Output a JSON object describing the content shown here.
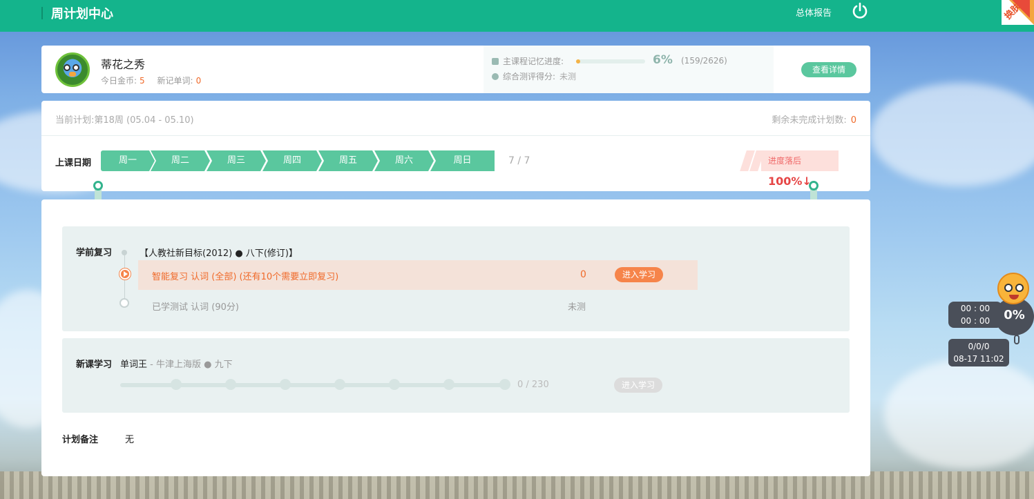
{
  "header": {
    "title": "周计划中心",
    "report_link": "总体报告",
    "skin_label": "换肤"
  },
  "profile": {
    "name": "蒂花之秀",
    "coins_label": "今日金币:",
    "coins": "5",
    "new_words_label": "新记单词:",
    "new_words": "0",
    "memory_label": "主课程记忆进度:",
    "memory_percent": "6%",
    "memory_fraction": "(159/2626)",
    "memory_progress": 0.06,
    "eval_label": "综合测评得分:",
    "eval_value": "未测",
    "detail_button": "查看详情"
  },
  "plan": {
    "current": "当前计划:第18周 (05.04 - 05.10)",
    "remain_label": "剩余未完成计划数:",
    "remain": "0",
    "date_label": "上课日期",
    "days": [
      "周一",
      "周二",
      "周三",
      "周四",
      "周五",
      "周六",
      "周日"
    ],
    "day_count": "7 / 7",
    "behind_label": "进度落后",
    "behind_value": "100%↓"
  },
  "review": {
    "label": "学前复习",
    "book": "【人教社新目标(2012) ● 八下(修订)】",
    "row1_text": "智能复习 认词 (全部) (还有10个需要立即复习)",
    "row1_count": "0",
    "row1_button": "进入学习",
    "row2_text": "已学测试 认词 (90分)",
    "row2_status": "未测"
  },
  "new_lesson": {
    "label": "新课学习",
    "course": "单词王",
    "course_sub": " - 牛津上海版 ● 九下",
    "count": "0 / 230",
    "button": "进入学习"
  },
  "notes": {
    "label": "计划备注",
    "value": "无"
  },
  "widget": {
    "time1": "00 : 00",
    "time2": "00 : 00",
    "percent": "0%",
    "stat": "0/0/0",
    "datetime": "08-17 11:02"
  },
  "colors": {
    "brand": "#14b48c",
    "accent": "#5ac79e",
    "warning": "#f06a2a",
    "danger": "#e64545"
  }
}
